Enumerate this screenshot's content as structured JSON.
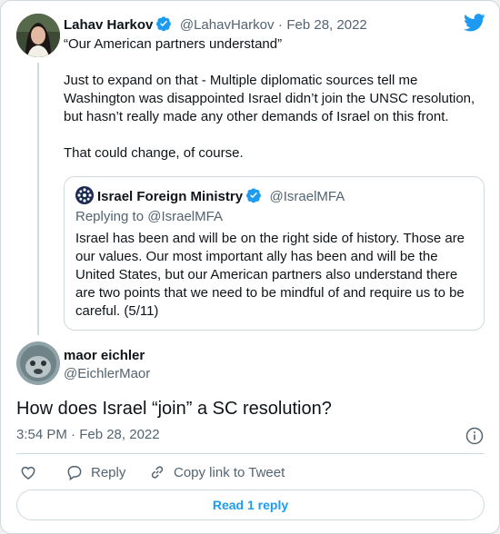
{
  "colors": {
    "accent": "#1d9bf0",
    "muted": "#536471",
    "border": "#cfd9de",
    "verified": "#1d9bf0"
  },
  "parent_tweet": {
    "name": "Lahav Harkov",
    "handle": "@LahavHarkov",
    "separator": "·",
    "date": "Feb 28, 2022",
    "text": "“Our American partners understand”\n\nJust to expand on that - Multiple diplomatic sources tell me Washington was disappointed Israel didn’t join the UNSC resolution, but hasn’t really made any other demands of Israel on this front.\n\nThat could change, of course.",
    "verified": true
  },
  "quoted_tweet": {
    "name": "Israel Foreign Ministry",
    "handle": "@IsraelMFA",
    "replying_to": "Replying to @IsraelMFA",
    "text": "Israel has been and will be on the right side of history. Those are our values. Our most important ally has been and will be the United States, but our American partners also understand there are two points that we need to be mindful of and require us to be careful. (5/11)",
    "verified": true
  },
  "main_tweet": {
    "name": "maor eichler",
    "handle": "@EichlerMaor",
    "text": "How does Israel “join” a SC resolution?",
    "timestamp": "3:54 PM · Feb 28, 2022"
  },
  "actions": {
    "like": "",
    "reply": "Reply",
    "copy_link": "Copy link to Tweet"
  },
  "read_replies": "Read 1 reply",
  "icons": [
    "twitter-bird-icon",
    "verified-badge-icon",
    "info-icon",
    "heart-icon",
    "reply-icon",
    "link-icon"
  ]
}
